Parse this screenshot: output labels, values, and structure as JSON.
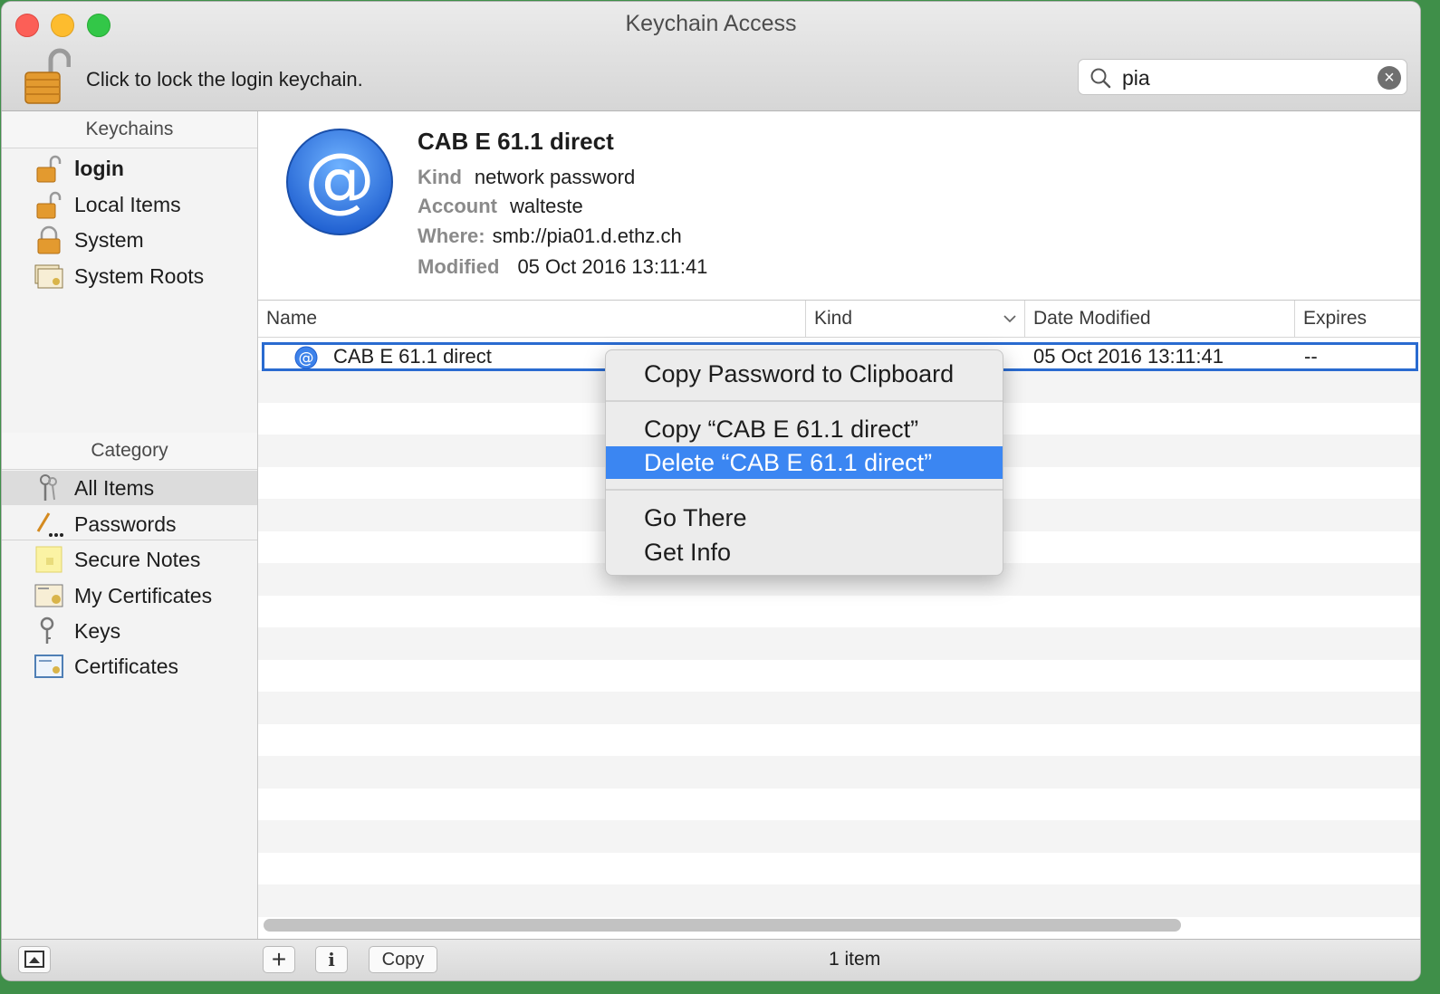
{
  "window": {
    "title": "Keychain Access"
  },
  "toolbar": {
    "lock_text": "Click to lock the login keychain.",
    "search_value": "pia",
    "search_clear": "×"
  },
  "sidebar": {
    "keychains_header": "Keychains",
    "keychains": [
      {
        "label": "login",
        "icon": "unlocked-padlock-icon"
      },
      {
        "label": "Local Items",
        "icon": "unlocked-padlock-icon"
      },
      {
        "label": "System",
        "icon": "locked-padlock-icon"
      },
      {
        "label": "System Roots",
        "icon": "certificate-stack-icon"
      }
    ],
    "category_header": "Category",
    "categories": [
      {
        "label": "All Items",
        "icon": "keys-icon"
      },
      {
        "label": "Passwords",
        "icon": "pencil-dots-icon"
      },
      {
        "label": "Secure Notes",
        "icon": "note-icon"
      },
      {
        "label": "My Certificates",
        "icon": "certificate-person-icon"
      },
      {
        "label": "Keys",
        "icon": "key-icon"
      },
      {
        "label": "Certificates",
        "icon": "certificate-icon"
      }
    ]
  },
  "detail": {
    "name": "CAB E 61.1 direct",
    "kind_label": "Kind",
    "kind_value": "network password",
    "account_label": "Account",
    "account_value": "walteste",
    "where_label": "Where:",
    "where_value": "smb://pia01.d.ethz.ch",
    "modified_label": "Modified",
    "modified_value": "05 Oct 2016 13:11:41"
  },
  "table": {
    "columns": [
      "Name",
      "Kind",
      "Date Modified",
      "Expires"
    ],
    "rows": [
      {
        "name": "CAB E 61.1 direct",
        "date_modified": "05 Oct 2016 13:11:41",
        "expires": "--"
      }
    ]
  },
  "context_menu": {
    "items": [
      "Copy Password to Clipboard",
      "Copy “CAB E 61.1 direct”",
      "Delete “CAB E 61.1 direct”",
      "Go There",
      "Get Info"
    ]
  },
  "bottombar": {
    "add_label": "+",
    "info_label": "i",
    "copy_label": "Copy",
    "status": "1 item"
  },
  "colors": {
    "selection_blue": "#3b86f2",
    "row_border_blue": "#2a6bd0",
    "desktop_green": "#3f8f49"
  }
}
